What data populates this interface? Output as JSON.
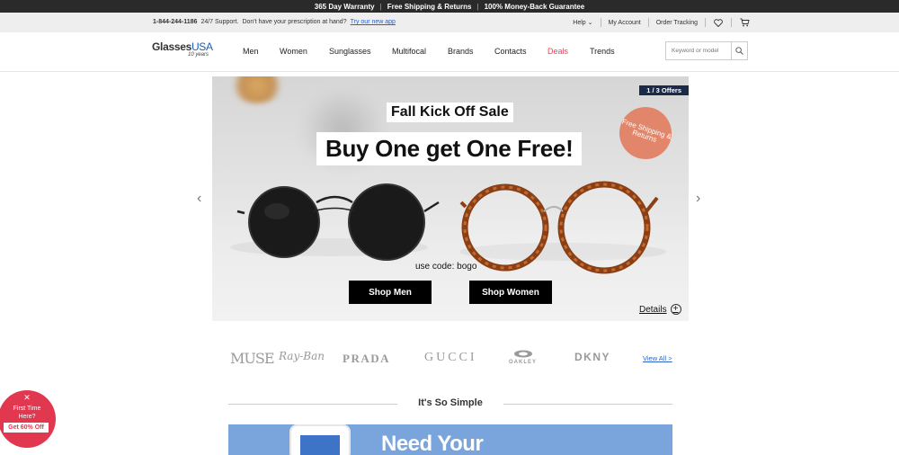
{
  "topbar": {
    "items": [
      "365 Day Warranty",
      "Free Shipping & Returns",
      "100% Money-Back Guarantee"
    ],
    "separator": "|"
  },
  "utility": {
    "phone": "1-844-244-1186",
    "support": "24/7 Support.",
    "prescription_text": "Don't have your prescription at hand?",
    "app_link": "Try our new app",
    "help": "Help",
    "account": "My Account",
    "order_tracking": "Order Tracking"
  },
  "nav": {
    "logo_main": "Glasses",
    "logo_accent": "USA",
    "logo_tag": "10 years",
    "links": [
      "Men",
      "Women",
      "Sunglasses",
      "Multifocal",
      "Brands",
      "Contacts",
      "Deals",
      "Trends"
    ],
    "search_placeholder": "Keyword or model"
  },
  "hero": {
    "counter": "1 / 3 Offers",
    "kicker": "Fall Kick Off Sale",
    "headline": "Buy One get One Free!",
    "badge": "Free Shipping & Returns",
    "code_text": "use code: bogo",
    "btn_men": "Shop Men",
    "btn_women": "Shop Women",
    "details": "Details",
    "prev": "‹",
    "next": "›"
  },
  "brands": {
    "muse": "MUSE",
    "rayban": "Ray-Ban",
    "prada": "PRADA",
    "gucci": "GUCCI",
    "oakley": "OAKLEY",
    "dkny": "DKNY",
    "view_all": "View All >"
  },
  "simple": {
    "title": "It's So Simple",
    "promo_headline": "Need Your"
  },
  "popup": {
    "close": "✕",
    "line1": "First Time",
    "line2": "Here?",
    "offer": "Get 60% Off"
  },
  "colors": {
    "accent_blue": "#1a5bb8",
    "deals_red": "#e8425a",
    "popup_red": "#e1384f",
    "badge_peach": "#e2866b",
    "counter_navy": "#1c2a4a"
  }
}
